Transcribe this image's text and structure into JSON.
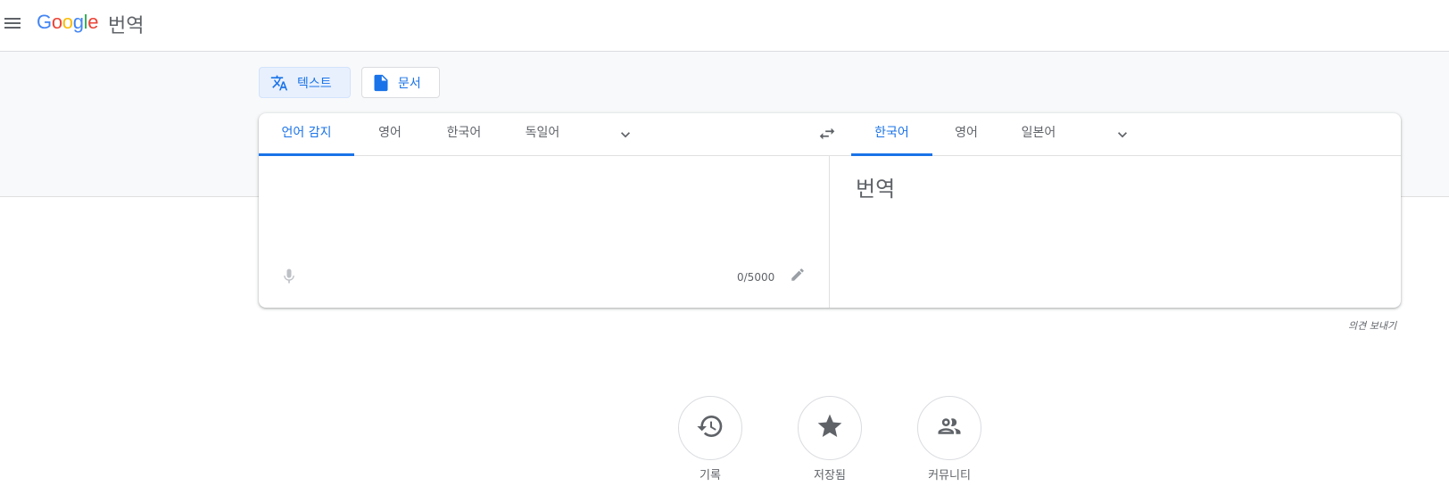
{
  "header": {
    "logo": [
      "G",
      "o",
      "o",
      "g",
      "l",
      "e"
    ],
    "product_name": "번역"
  },
  "modes": [
    {
      "label": "텍스트",
      "icon": "translate-icon",
      "active": true
    },
    {
      "label": "문서",
      "icon": "document-icon",
      "active": false
    }
  ],
  "source_languages": {
    "tabs": [
      {
        "label": "언어 감지",
        "selected": true
      },
      {
        "label": "영어",
        "selected": false
      },
      {
        "label": "한국어",
        "selected": false
      },
      {
        "label": "독일어",
        "selected": false
      }
    ]
  },
  "target_languages": {
    "tabs": [
      {
        "label": "한국어",
        "selected": true
      },
      {
        "label": "영어",
        "selected": false
      },
      {
        "label": "일본어",
        "selected": false
      }
    ]
  },
  "source": {
    "value": "",
    "char_counter": "0/5000"
  },
  "target": {
    "placeholder": "번역"
  },
  "feedback_link": "의견 보내기",
  "actions": [
    {
      "label": "기록",
      "icon": "history-icon"
    },
    {
      "label": "저장됨",
      "icon": "star-icon"
    },
    {
      "label": "커뮤니티",
      "icon": "community-icon"
    }
  ],
  "colors": {
    "accent": "#1a73e8",
    "band": "#f8f9fa",
    "icon_grey": "#5f6368"
  }
}
